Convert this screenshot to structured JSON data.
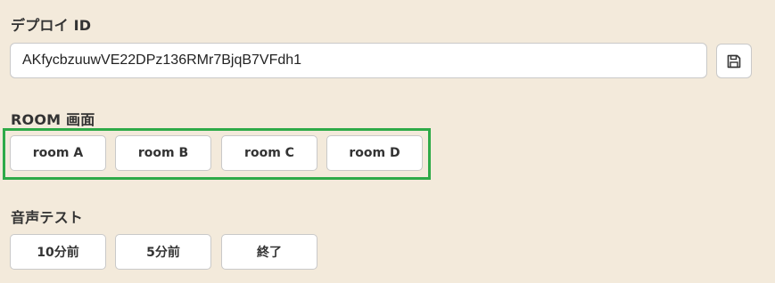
{
  "deploy": {
    "title": "デプロイ ID",
    "input_value": "AKfycbzuuwVE22DPz136RMr7BjqB7VFdh1",
    "save_icon": "floppy-disk-icon"
  },
  "room": {
    "title": "ROOM 画面",
    "buttons": [
      "room A",
      "room B",
      "room C",
      "room D"
    ],
    "highlight_color": "#2eaa48"
  },
  "audio": {
    "title": "音声テスト",
    "buttons": [
      "10分前",
      "5分前",
      "終了"
    ]
  },
  "colors": {
    "background": "#f3eadb",
    "text": "#333333",
    "border": "#c9c9c9"
  }
}
